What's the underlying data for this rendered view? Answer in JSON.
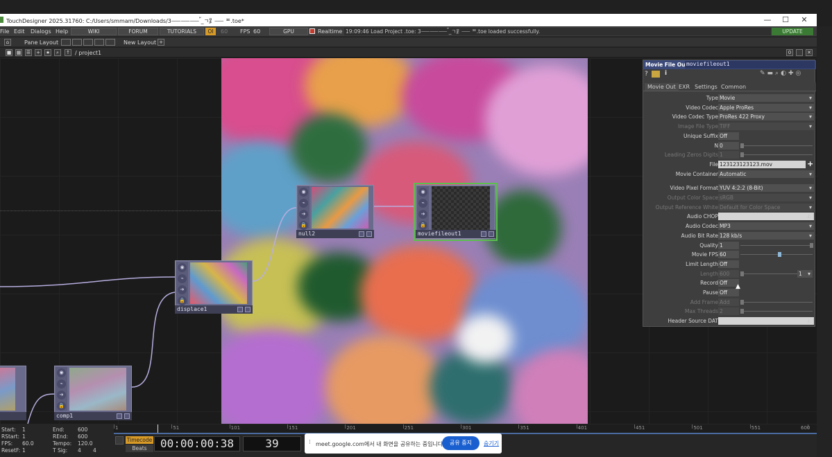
{
  "window": {
    "title": "TouchDesigner 2025.31760: C:/Users/smmam/Downloads/3⸺⸺⸺ ้_ㄱ⻊⸺ ᄑ.toe*",
    "minimize": "—",
    "maximize": "☐",
    "close": "✕"
  },
  "menu": {
    "items": [
      "File",
      "Edit",
      "Dialogs",
      "Help"
    ],
    "wiki": "WIKI",
    "forum": "FORUM",
    "tutorials": "TUTORIALS",
    "ol": "OI",
    "sixty": "60",
    "fps_label": "FPS",
    "fps_value": "60",
    "gpu": "GPU",
    "realtime": "Realtime",
    "status": "19:09:46 Load Project .toe: 3⸺⸺⸺ ้_ㄱ⻊⸺ ᄑ.toe loaded successfully.",
    "update": "UPDATE"
  },
  "toolbar": {
    "pane_layout": "Pane Layout",
    "new_layout": "New Layout",
    "path": "/ project1",
    "counter": "0"
  },
  "nodes": {
    "null": "null2",
    "moviefileout": "moviefileout1",
    "displace": "displace1",
    "comp": "comp1"
  },
  "params": {
    "op_type": "Movie File Out",
    "op_name": "moviefileout1",
    "tabs": [
      "Movie Out",
      "EXR",
      "Settings",
      "Common"
    ],
    "rows": [
      {
        "label": "Type",
        "value": "Movie",
        "menu": true,
        "dis": false
      },
      {
        "label": "Video Codec",
        "value": "Apple ProRes",
        "menu": true,
        "dis": false
      },
      {
        "label": "Video Codec Type",
        "value": "ProRes 422 Proxy",
        "menu": true,
        "dis": false
      },
      {
        "label": "Image File Type",
        "value": "TIFF",
        "menu": true,
        "dis": true
      },
      {
        "label": "Unique Suffix",
        "value": "Off",
        "menu": false,
        "dis": false
      },
      {
        "label": "N",
        "value": "0",
        "menu": false,
        "dis": false
      },
      {
        "label": "Leading Zeros Digits",
        "value": "1",
        "menu": false,
        "dis": true
      },
      {
        "label": "File",
        "value": "123123123123.mov",
        "menu": false,
        "dis": false
      },
      {
        "label": "Movie Container",
        "value": "Automatic",
        "menu": true,
        "dis": false
      },
      {
        "label": "Video Pixel Format",
        "value": "YUV 4:2:2 (8-Bit)",
        "menu": true,
        "dis": false
      },
      {
        "label": "Output Color Space",
        "value": "sRGB",
        "menu": true,
        "dis": true
      },
      {
        "label": "Output Reference White",
        "value": "Default for Color Space",
        "menu": true,
        "dis": true
      },
      {
        "label": "Audio CHOP",
        "value": "",
        "menu": false,
        "dis": false
      },
      {
        "label": "Audio Codec",
        "value": "MP3",
        "menu": true,
        "dis": false
      },
      {
        "label": "Audio Bit Rate",
        "value": "128 kb/s",
        "menu": true,
        "dis": false
      },
      {
        "label": "Quality",
        "value": "1",
        "menu": false,
        "dis": false
      },
      {
        "label": "Movie FPS",
        "value": "60",
        "menu": false,
        "dis": false
      },
      {
        "label": "Limit Length",
        "value": "Off",
        "menu": false,
        "dis": false
      },
      {
        "label": "Length",
        "value": "600",
        "menu": false,
        "dis": true
      },
      {
        "label": "Record",
        "value": "Off",
        "menu": false,
        "dis": false
      },
      {
        "label": "Pause",
        "value": "Off",
        "menu": false,
        "dis": false
      },
      {
        "label": "Add Frame",
        "value": "Add",
        "menu": false,
        "dis": true
      },
      {
        "label": "Max Threads",
        "value": "2",
        "menu": false,
        "dis": true
      },
      {
        "label": "Header Source DAT",
        "value": "",
        "menu": false,
        "dis": false
      }
    ],
    "length_unit": "1"
  },
  "timeline": {
    "start_label": "Start:",
    "start": "1",
    "rstart_label": "RStart:",
    "rstart": "1",
    "fps_label": "FPS:",
    "fps": "60.0",
    "resetf_label": "ResetF:",
    "resetf": "1",
    "end_label": "End:",
    "end": "600",
    "rend_label": "REnd:",
    "rend": "600",
    "tempo_label": "Tempo:",
    "tempo": "120.0",
    "tsig_label": "T Sig:",
    "tsig1": "4",
    "tsig2": "4",
    "timecode_btn": "Timecode",
    "beats_btn": "Beats",
    "timecode": "00:00:00:38",
    "frame": "39",
    "ticks": [
      "1",
      "51",
      "101",
      "151",
      "201",
      "251",
      "301",
      "351",
      "401",
      "451",
      "501",
      "551",
      "600"
    ]
  },
  "share_bar": {
    "text": "meet.google.com에서 내 화면을 공유하는 중입니다.",
    "stop": "공유 중지",
    "hide": "숨기기"
  }
}
